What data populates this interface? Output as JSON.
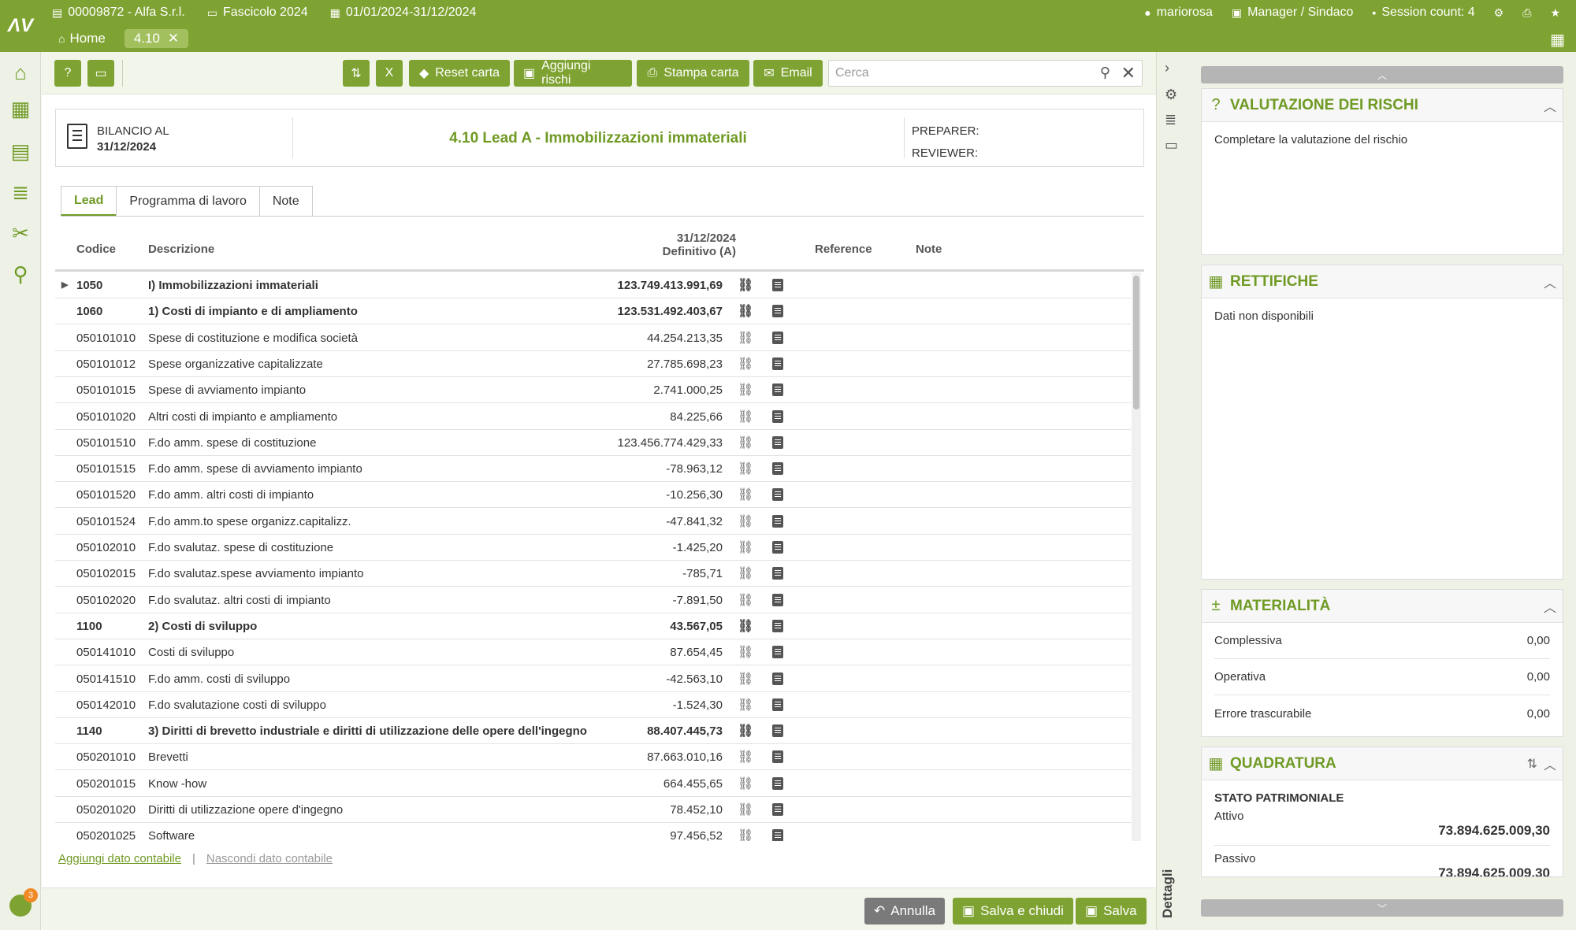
{
  "topbar": {
    "company": "00009872 - Alfa S.r.l.",
    "folder": "Fascicolo 2024",
    "period": "01/01/2024-31/12/2024",
    "user": "mariorosa",
    "role": "Manager / Sindaco",
    "session": "Session count: 4"
  },
  "nav": {
    "home": "Home",
    "tab": "4.10"
  },
  "toolbar": {
    "reset": "Reset carta",
    "add_risks": "Aggiungi rischi",
    "print": "Stampa carta",
    "email": "Email",
    "search_placeholder": "Cerca"
  },
  "header": {
    "balance_label": "BILANCIO AL",
    "balance_date": "31/12/2024",
    "title": "4.10 Lead A - Immobilizzazioni immateriali",
    "preparer": "PREPARER:",
    "reviewer": "REVIEWER:"
  },
  "tabs": [
    "Lead",
    "Programma di lavoro",
    "Note"
  ],
  "columns": {
    "code": "Codice",
    "desc": "Descrizione",
    "date": "31/12/2024",
    "def": "Definitivo (A)",
    "ref": "Reference",
    "note": "Note"
  },
  "rows": [
    {
      "code": "1050",
      "desc": "I) Immobilizzazioni immateriali",
      "val": "123.749.413.991,69",
      "bold": true,
      "expand": true
    },
    {
      "code": "1060",
      "desc": "1) Costi di impianto e di ampliamento",
      "val": "123.531.492.403,67",
      "bold": true
    },
    {
      "code": "050101010",
      "desc": "Spese di costituzione e modifica società",
      "val": "44.254.213,35"
    },
    {
      "code": "050101012",
      "desc": "Spese organizzative capitalizzate",
      "val": "27.785.698,23"
    },
    {
      "code": "050101015",
      "desc": "Spese di avviamento impianto",
      "val": "2.741.000,25"
    },
    {
      "code": "050101020",
      "desc": "Altri costi di impianto e ampliamento",
      "val": "84.225,66"
    },
    {
      "code": "050101510",
      "desc": "F.do amm. spese di costituzione",
      "val": "123.456.774.429,33"
    },
    {
      "code": "050101515",
      "desc": "F.do amm. spese di avviamento impianto",
      "val": "-78.963,12"
    },
    {
      "code": "050101520",
      "desc": "F.do amm. altri costi di impianto",
      "val": "-10.256,30"
    },
    {
      "code": "050101524",
      "desc": "F.do amm.to spese organizz.capitalizz.",
      "val": "-47.841,32"
    },
    {
      "code": "050102010",
      "desc": "F.do svalutaz. spese di costituzione",
      "val": "-1.425,20"
    },
    {
      "code": "050102015",
      "desc": "F.do svalutaz.spese avviamento impianto",
      "val": "-785,71"
    },
    {
      "code": "050102020",
      "desc": "F.do svalutaz. altri costi di impianto",
      "val": "-7.891,50"
    },
    {
      "code": "1100",
      "desc": "2) Costi di sviluppo",
      "val": "43.567,05",
      "bold": true
    },
    {
      "code": "050141010",
      "desc": "Costi di sviluppo",
      "val": "87.654,45"
    },
    {
      "code": "050141510",
      "desc": "F.do amm. costi di sviluppo",
      "val": "-42.563,10"
    },
    {
      "code": "050142010",
      "desc": "F.do svalutazione costi di sviluppo",
      "val": "-1.524,30"
    },
    {
      "code": "1140",
      "desc": "3) Diritti di brevetto industriale e diritti di utilizzazione delle opere dell'ingegno",
      "val": "88.407.445,73",
      "bold": true
    },
    {
      "code": "050201010",
      "desc": "Brevetti",
      "val": "87.663.010,16"
    },
    {
      "code": "050201015",
      "desc": "Know -how",
      "val": "664.455,65"
    },
    {
      "code": "050201020",
      "desc": "Diritti di utilizzazione opere d'ingegno",
      "val": "78.452,10"
    },
    {
      "code": "050201025",
      "desc": "Software",
      "val": "97.456,52"
    }
  ],
  "links": {
    "add": "Aggiungi dato contabile",
    "hide": "Nascondi dato contabile"
  },
  "footer": {
    "cancel": "Annulla",
    "save_close": "Salva e chiudi",
    "save": "Salva"
  },
  "strip": {
    "details": "Dettagli"
  },
  "panels": {
    "risks": {
      "title": "VALUTAZIONE DEI RISCHI",
      "text": "Completare la valutazione del rischio"
    },
    "adjust": {
      "title": "RETTIFICHE",
      "text": "Dati non disponibili"
    },
    "materiality": {
      "title": "MATERIALITÀ",
      "items": [
        {
          "label": "Complessiva",
          "value": "0,00"
        },
        {
          "label": "Operativa",
          "value": "0,00"
        },
        {
          "label": "Errore trascurabile",
          "value": "0,00"
        }
      ]
    },
    "balance": {
      "title": "QUADRATURA",
      "section": "STATO PATRIMONIALE",
      "asset_label": "Attivo",
      "asset_value": "73.894.625.009,30",
      "liab_label": "Passivo",
      "liab_value": "73.894.625.009,30"
    }
  },
  "colors": {
    "accent": "#7fa332",
    "dark_accent": "#6f9a24",
    "cancel": "#7a7a7a"
  },
  "user_badge": "3"
}
